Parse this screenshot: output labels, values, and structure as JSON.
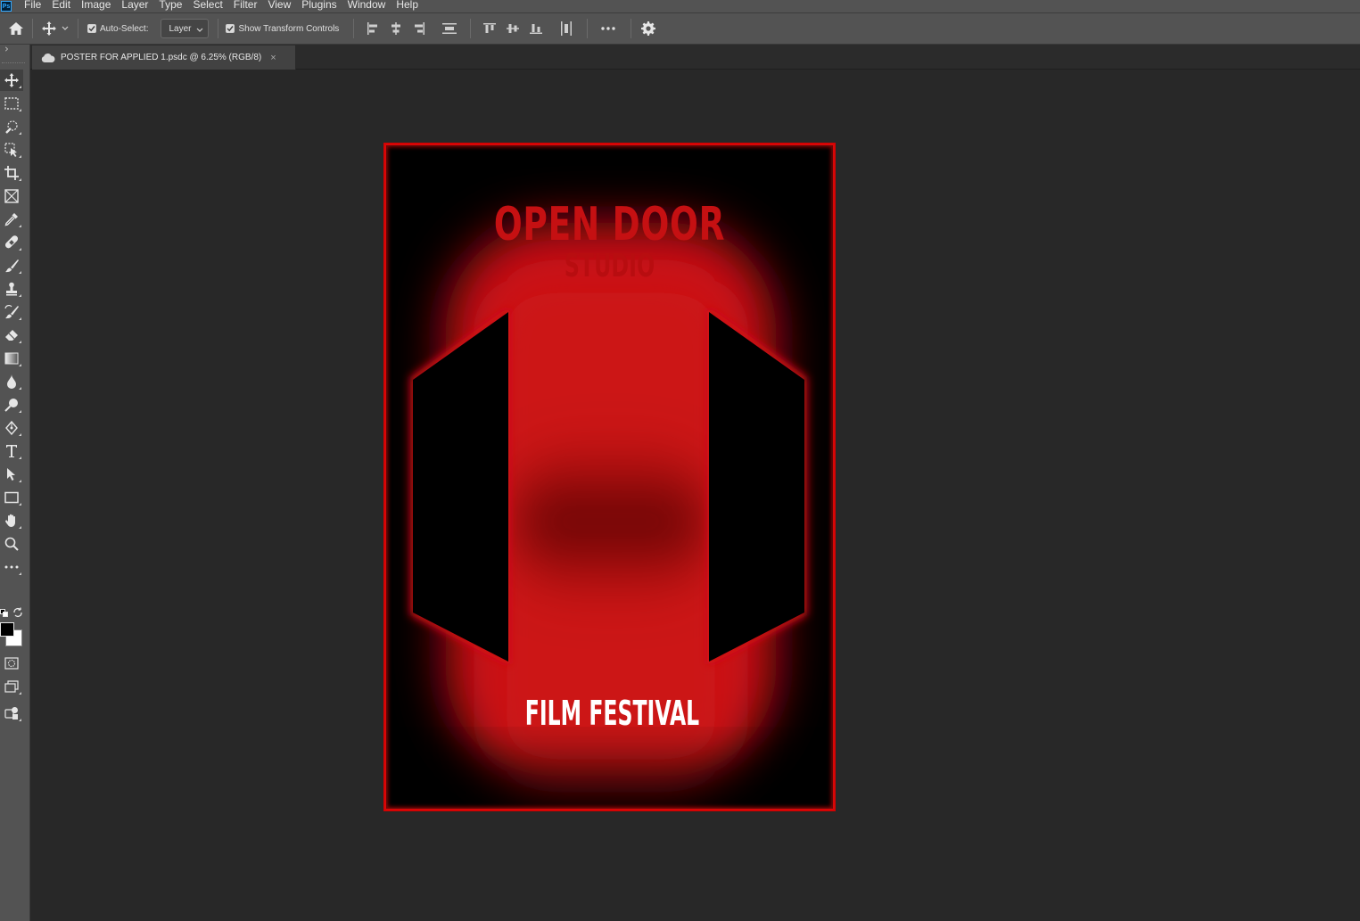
{
  "menubar": {
    "logo": "Ps",
    "items": [
      "File",
      "Edit",
      "Image",
      "Layer",
      "Type",
      "Select",
      "Filter",
      "View",
      "Plugins",
      "Window",
      "Help"
    ]
  },
  "options": {
    "auto_select_label": "Auto-Select:",
    "auto_select_checked": true,
    "layer_select_value": "Layer",
    "show_transform_label": "Show Transform Controls",
    "show_transform_checked": true
  },
  "document_tab": {
    "title": "POSTER FOR APPLIED 1.psdc @ 6.25% (RGB/8)",
    "close_glyph": "×"
  },
  "poster": {
    "title_main": "OPEN DOOR",
    "title_sub": "STUDIO",
    "subtitle": "FILM FESTIVAL",
    "colors": {
      "accent_red": "#c51012",
      "background": "#000000",
      "text_white": "#ffffff"
    }
  },
  "tools": [
    "move-tool",
    "marquee-tool",
    "quick-select-tool",
    "object-select-tool",
    "crop-tool",
    "frame-tool",
    "eyedropper-tool",
    "healing-brush-tool",
    "brush-tool",
    "clone-stamp-tool",
    "history-brush-tool",
    "eraser-tool",
    "gradient-tool",
    "blur-tool",
    "dodge-tool",
    "pen-tool",
    "type-tool",
    "path-select-tool",
    "rectangle-tool",
    "hand-tool",
    "zoom-tool",
    "more-tools"
  ],
  "swatches": {
    "foreground": "#000000",
    "background": "#ffffff"
  }
}
